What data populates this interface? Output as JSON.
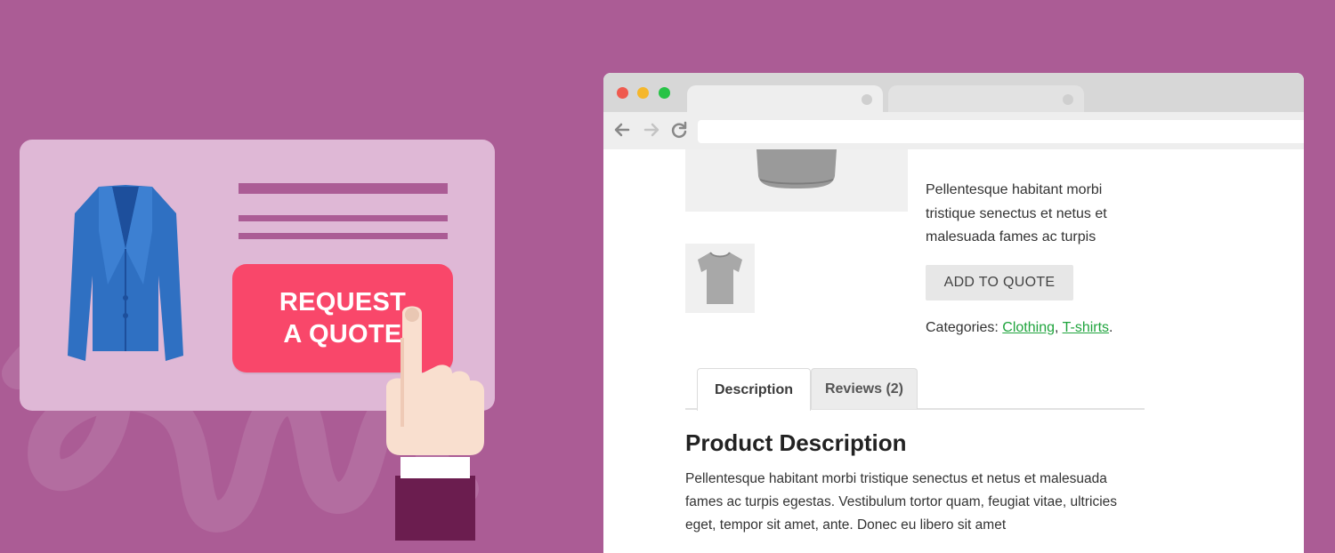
{
  "promo": {
    "button_label": "REQUEST\nA QUOTE"
  },
  "browser": {
    "traffic_lights": [
      "#ef5a4f",
      "#f5b72b",
      "#27c346"
    ],
    "address": ""
  },
  "product": {
    "short_description": "Pellentesque habitant morbi tristique senectus et netus et malesuada fames ac turpis",
    "add_to_quote_label": "ADD TO QUOTE",
    "categories_label": "Categories:",
    "category_links": [
      "Clothing",
      "T-shirts"
    ],
    "category_separator": ",",
    "category_end": ".",
    "tabs": [
      {
        "label": "Description",
        "active": true
      },
      {
        "label": "Reviews (2)",
        "active": false
      }
    ],
    "section_title": "Product Description",
    "description": "Pellentesque habitant morbi tristique senectus et netus et malesuada fames ac turpis egestas. Vestibulum tortor quam, feugiat vitae, ultricies eget, tempor sit amet, ante. Donec eu libero sit amet"
  },
  "colors": {
    "background": "#ab5c95",
    "card": "#dfb8d6",
    "cta": "#f9476a",
    "link": "#1fa43d"
  },
  "icons": [
    "jacket-illustration",
    "pointing-hand-icon",
    "back-arrow-icon",
    "forward-arrow-icon",
    "reload-icon",
    "tshirt-icon"
  ]
}
